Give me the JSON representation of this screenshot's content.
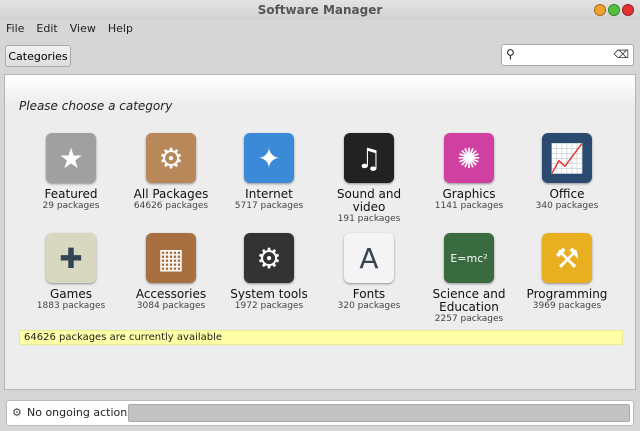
{
  "window": {
    "title": "Software Manager",
    "buttons": {
      "minimize_color": "#f0a030",
      "maximize_color": "#50c040",
      "close_color": "#e03030"
    }
  },
  "menu": [
    "File",
    "Edit",
    "View",
    "Help"
  ],
  "toolbar": {
    "categories_label": "Categories",
    "search": {
      "value": "",
      "placeholder": "",
      "icon": "search-icon",
      "clear_icon": "clear-icon"
    }
  },
  "main": {
    "prompt": "Please choose a category",
    "categories": [
      {
        "name": "Featured",
        "count": "29 packages",
        "icon": "star",
        "color": "#a0a0a0",
        "glyph": "★"
      },
      {
        "name": "All Packages",
        "count": "64626 packages",
        "icon": "package",
        "color": "#b8875a",
        "glyph": "⚙"
      },
      {
        "name": "Internet",
        "count": "5717 packages",
        "icon": "globe",
        "color": "#3a8ad8",
        "glyph": "✦"
      },
      {
        "name": "Sound and video",
        "count": "191 packages",
        "icon": "clapperboard-music",
        "color": "#222222",
        "glyph": "♫"
      },
      {
        "name": "Graphics",
        "count": "1141 packages",
        "icon": "color-wheel",
        "color": "#d040a0",
        "glyph": "✺"
      },
      {
        "name": "Office",
        "count": "340 packages",
        "icon": "chart",
        "color": "#2a4a70",
        "glyph": "📈"
      },
      {
        "name": "Games",
        "count": "1883 packages",
        "icon": "gamepad",
        "color": "#d8d8c0",
        "glyph": "✚"
      },
      {
        "name": "Accessories",
        "count": "3084 packages",
        "icon": "calculator",
        "color": "#a87040",
        "glyph": "▦"
      },
      {
        "name": "System tools",
        "count": "1972 packages",
        "icon": "cog",
        "color": "#333333",
        "glyph": "⚙"
      },
      {
        "name": "Fonts",
        "count": "320 packages",
        "icon": "font",
        "color": "#f4f4f4",
        "glyph": "A"
      },
      {
        "name": "Science and Education",
        "count": "2257 packages",
        "icon": "chalkboard",
        "color": "#3a6a40",
        "glyph": "E=mc²"
      },
      {
        "name": "Programming",
        "count": "3969 packages",
        "icon": "construction",
        "color": "#e8b020",
        "glyph": "⚒"
      }
    ],
    "info": "64626 packages are currently available"
  },
  "status": {
    "text": "No ongoing actions",
    "progress": 0
  }
}
